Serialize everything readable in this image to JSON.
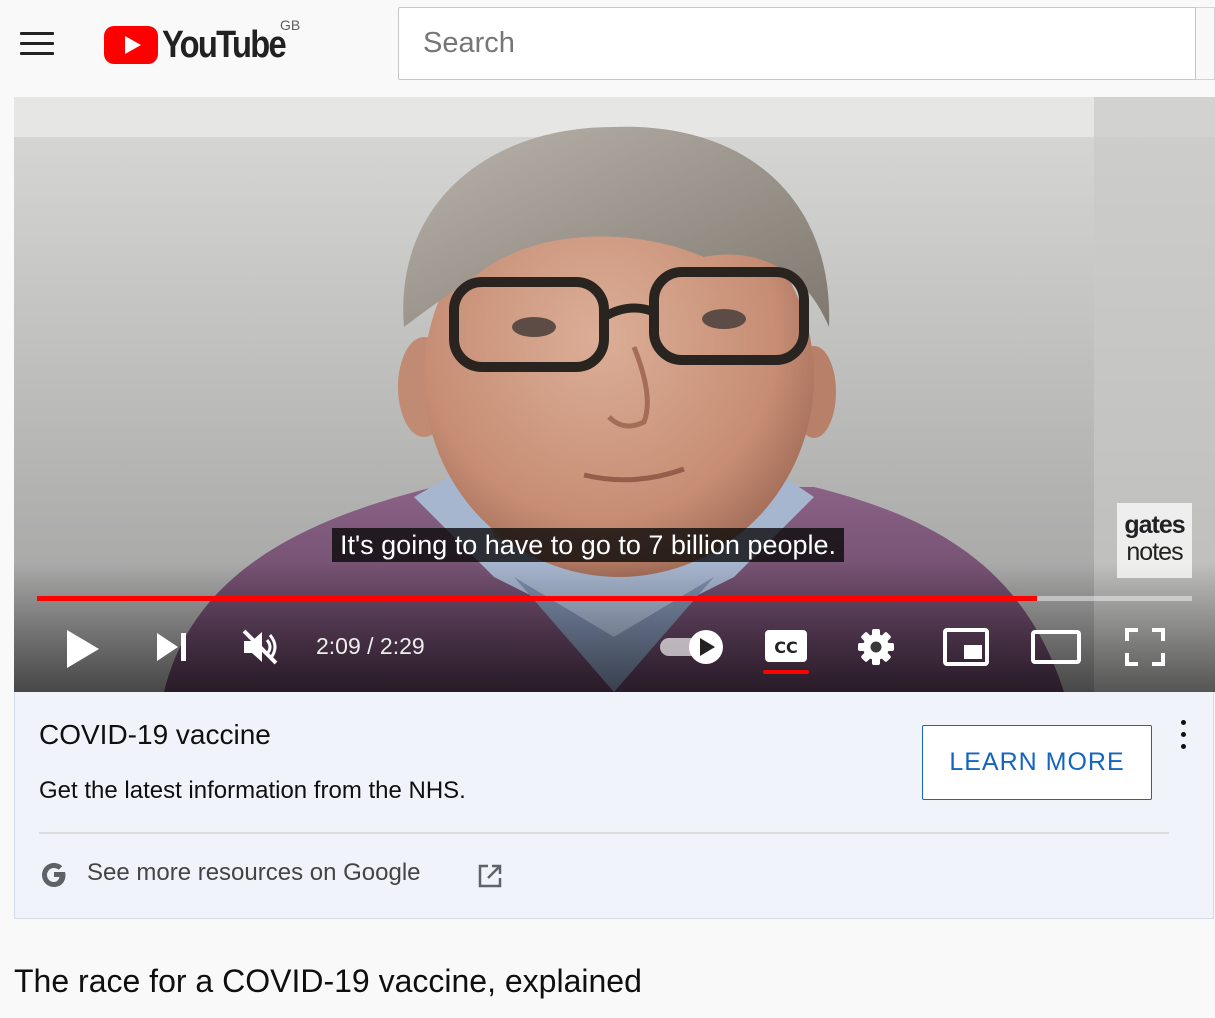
{
  "masthead": {
    "logo_text": "YouTube",
    "region": "GB",
    "search_placeholder": "Search",
    "search_value": ""
  },
  "player": {
    "caption": "It's going to have to go to 7 billion people.",
    "watermark_line1": "gates",
    "watermark_line2": "notes",
    "current_time": "2:09",
    "duration": "2:29",
    "time_display": "2:09 / 2:29",
    "progress_fraction": 0.866,
    "muted": true,
    "autoplay_on": true,
    "captions_on": true
  },
  "info_panel": {
    "title": "COVID-19 vaccine",
    "subtitle": "Get the latest information from the NHS.",
    "button_label": "LEARN MORE",
    "resources_text": "See more resources on Google"
  },
  "video": {
    "title": "The race for a COVID-19 vaccine, explained"
  },
  "colors": {
    "brand_red": "#ff0000",
    "link_blue": "#1565c0",
    "panel_bg": "#f0f4fa"
  },
  "icons": [
    "menu-icon",
    "youtube-logo-icon",
    "play-icon",
    "next-icon",
    "muted-volume-icon",
    "autoplay-toggle-icon",
    "captions-icon",
    "settings-gear-icon",
    "miniplayer-icon",
    "theater-mode-icon",
    "fullscreen-icon",
    "more-vert-icon",
    "google-g-icon",
    "external-link-icon"
  ]
}
